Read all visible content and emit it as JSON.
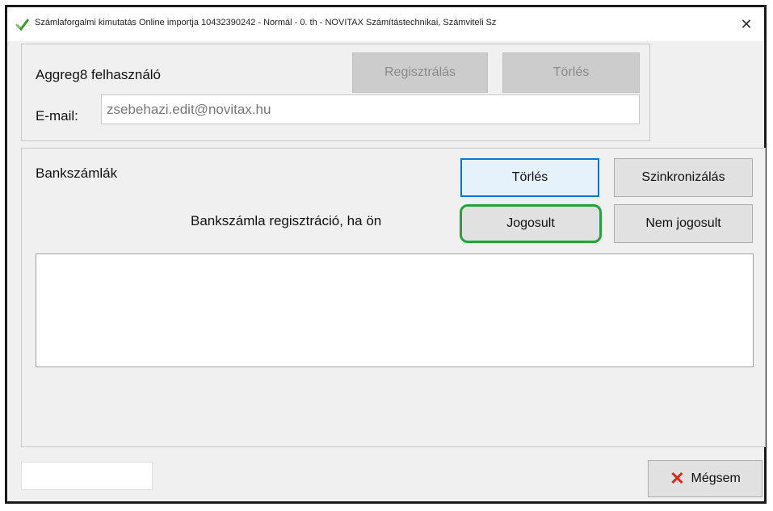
{
  "window": {
    "title": "Számlaforgalmi kimutatás Online importja 10432390242 - Normál - 0. th - NOVITAX Számítástechnikai, Számviteli Sz",
    "close_symbol": "✕",
    "icon": "checkmark-icon"
  },
  "aggregator": {
    "user_label": "Aggreg8 felhasználó",
    "register_label": "Regisztrálás",
    "delete_label": "Törlés",
    "email_label": "E-mail:",
    "email_value": "zsebehazi.edit@novitax.hu"
  },
  "bank": {
    "section_label": "Bankszámlák",
    "delete_label": "Törlés",
    "sync_label": "Szinkronizálás",
    "registration_text": "Bankszámla regisztráció, ha ön",
    "entitled_label": "Jogosult",
    "not_entitled_label": "Nem jogosult",
    "accounts": []
  },
  "footer": {
    "status_value": "",
    "cancel_label": "Mégsem",
    "cancel_icon": "x-icon"
  },
  "colors": {
    "highlight": "#22a33a",
    "focus": "#0078d7",
    "cancel_icon": "#e2231a"
  }
}
